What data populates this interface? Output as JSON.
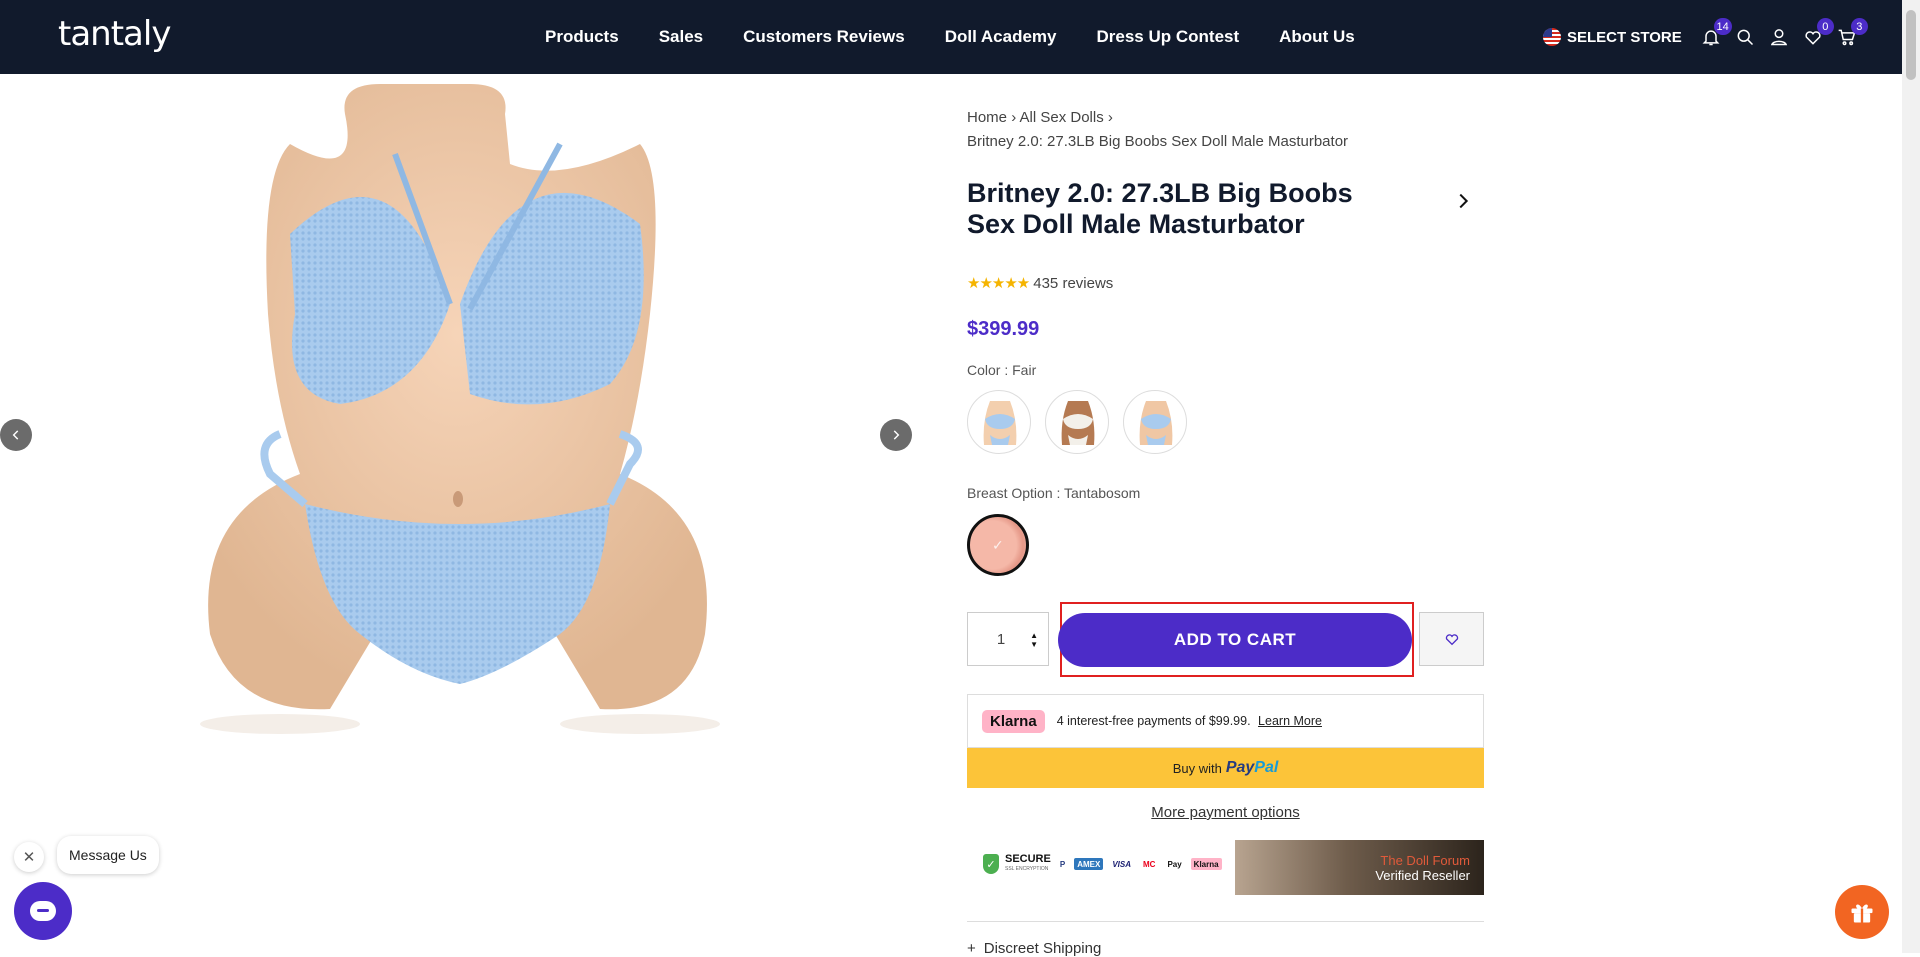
{
  "header": {
    "logo": "tantaly",
    "nav": [
      "Products",
      "Sales",
      "Customers Reviews",
      "Doll Academy",
      "Dress Up Contest",
      "About Us"
    ],
    "store_label": "SELECT STORE",
    "notifications_count": "14",
    "wishlist_count": "0",
    "cart_count": "3"
  },
  "breadcrumb": {
    "home": "Home",
    "category": "All Sex Dolls",
    "current": "Britney 2.0: 27.3LB Big Boobs Sex Doll Male Masturbator"
  },
  "product": {
    "title": "Britney 2.0: 27.3LB Big Boobs Sex Doll Male Masturbator",
    "stars": "★★★★★",
    "reviews": "435 reviews",
    "price": "$399.99",
    "color_label": "Color : Fair",
    "breast_label": "Breast Option : Tantabosom",
    "quantity": "1",
    "add_to_cart": "ADD TO CART"
  },
  "payment": {
    "klarna_logo": "Klarna",
    "klarna_text": "4 interest-free payments of $99.99.",
    "klarna_link": "Learn More",
    "paypal_prefix": "Buy with",
    "paypal_pay": "Pay",
    "paypal_pal": "Pal",
    "more_options": "More payment options",
    "secure_title": "SECURE",
    "secure_sub": "SSL ENCRYPTION",
    "card_icons": [
      "P",
      "AMEX",
      "VISA",
      "MC",
      "Pay",
      "Klarna"
    ],
    "forum_line1": "The Doll Forum",
    "forum_line2": "Verified Reseller"
  },
  "accordion": {
    "discreet_plus": "+",
    "discreet": "Discreet Shipping"
  },
  "chat": {
    "close": "✕",
    "message": "Message Us"
  },
  "colors": {
    "header_bg": "#111a2c",
    "accent": "#4c2cc8",
    "highlight_border": "#e02020",
    "paypal_yellow": "#fcc439",
    "gift_orange": "#f26522"
  }
}
